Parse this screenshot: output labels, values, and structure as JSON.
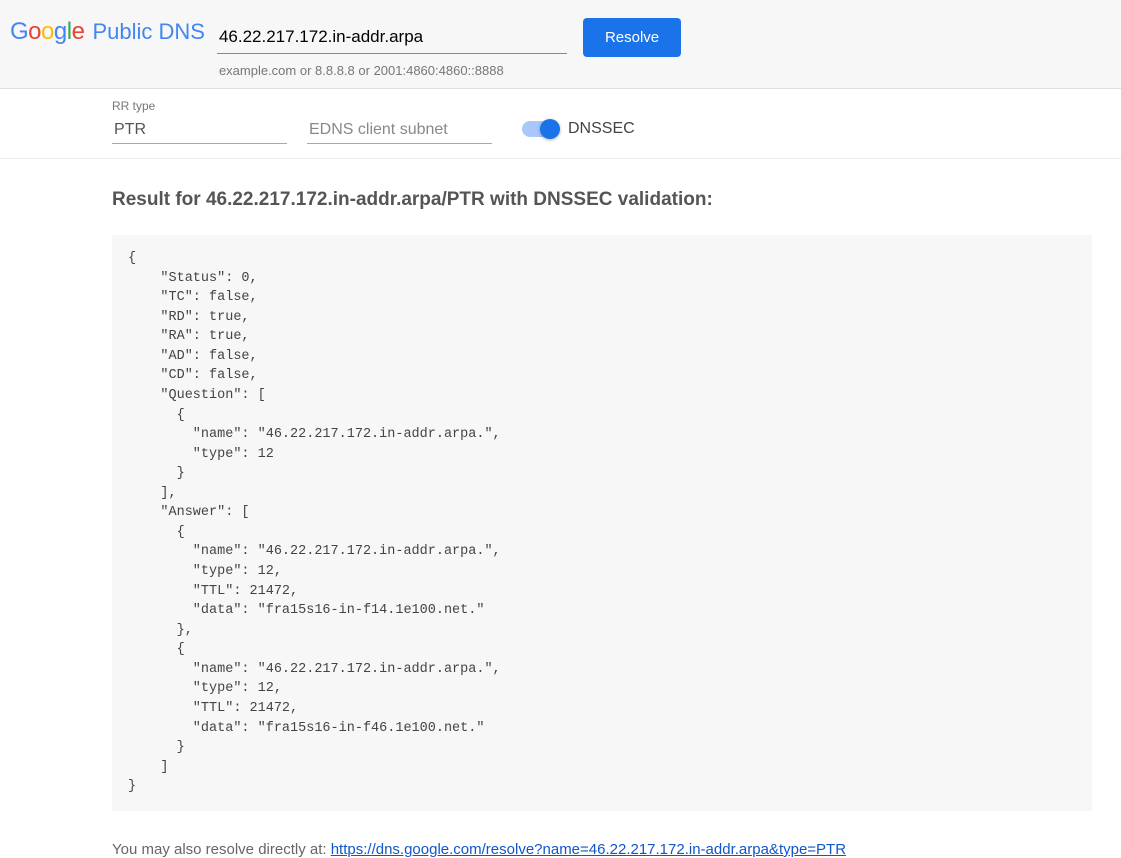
{
  "header": {
    "product_name": "Public DNS",
    "query_value": "46.22.217.172.in-addr.arpa",
    "query_hint": "example.com or 8.8.8.8 or 2001:4860:4860::8888",
    "resolve_label": "Resolve"
  },
  "options": {
    "rrtype_label": "RR type",
    "rrtype_value": "PTR",
    "edns_placeholder": "EDNS client subnet",
    "edns_value": "",
    "dnssec_label": "DNSSEC",
    "dnssec_on": true
  },
  "result": {
    "heading": "Result for 46.22.217.172.in-addr.arpa/PTR with DNSSEC validation:",
    "json_text": "{\n    \"Status\": 0,\n    \"TC\": false,\n    \"RD\": true,\n    \"RA\": true,\n    \"AD\": false,\n    \"CD\": false,\n    \"Question\": [\n      {\n        \"name\": \"46.22.217.172.in-addr.arpa.\",\n        \"type\": 12\n      }\n    ],\n    \"Answer\": [\n      {\n        \"name\": \"46.22.217.172.in-addr.arpa.\",\n        \"type\": 12,\n        \"TTL\": 21472,\n        \"data\": \"fra15s16-in-f14.1e100.net.\"\n      },\n      {\n        \"name\": \"46.22.217.172.in-addr.arpa.\",\n        \"type\": 12,\n        \"TTL\": 21472,\n        \"data\": \"fra15s16-in-f46.1e100.net.\"\n      }\n    ]\n}"
  },
  "direct": {
    "prefix": "You may also resolve directly at: ",
    "url_text": "https://dns.google.com/resolve?name=46.22.217.172.in-addr.arpa&type=PTR"
  }
}
